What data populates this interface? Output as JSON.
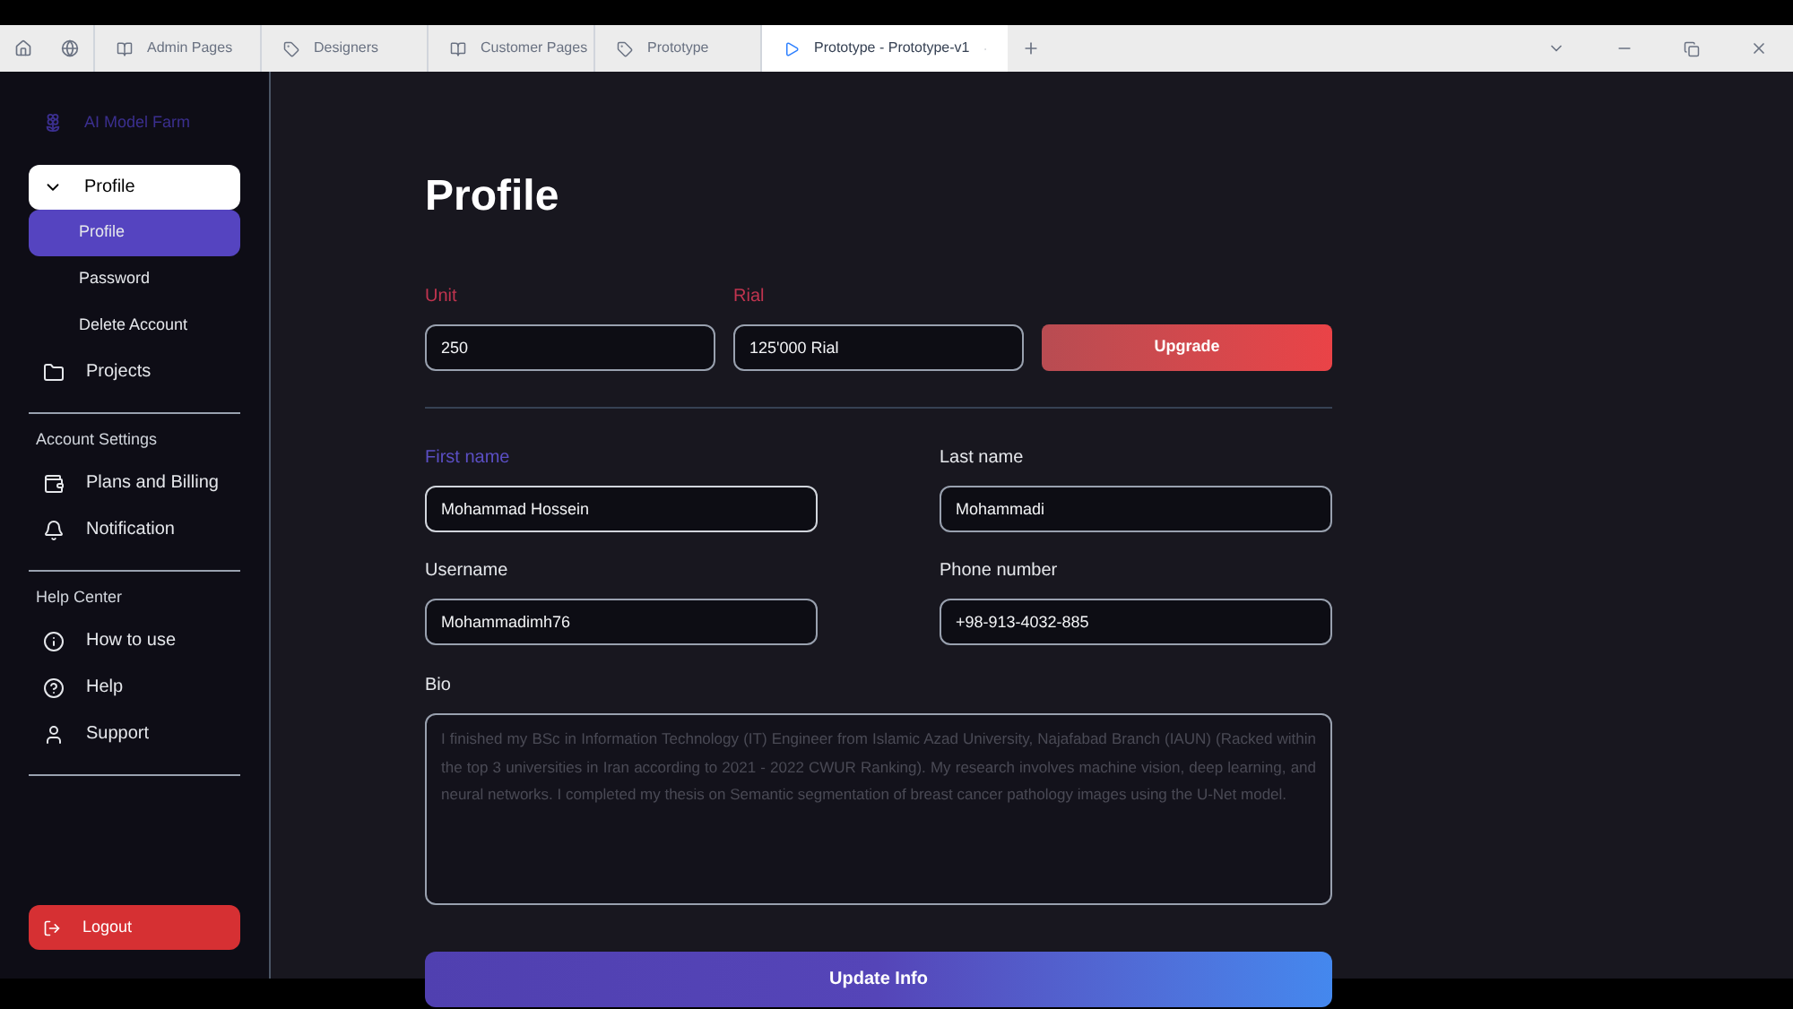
{
  "browser": {
    "tabs": [
      {
        "label": "Admin Pages",
        "selected": false
      },
      {
        "label": "Designers",
        "selected": false
      },
      {
        "label": "Customer Pages",
        "selected": false
      },
      {
        "label": "Prototype",
        "selected": false
      },
      {
        "label": "Prototype - Prototype-v1",
        "selected": true
      }
    ]
  },
  "sidebar": {
    "brand": "AI Model Farm",
    "group": {
      "label": "Profile",
      "expanded": true,
      "children": [
        {
          "label": "Profile",
          "selected": true
        },
        {
          "label": "Password",
          "selected": false
        },
        {
          "label": "Delete Account",
          "selected": false
        }
      ]
    },
    "items": [
      {
        "label": "Projects"
      }
    ],
    "sections": [
      {
        "title": "Account Settings",
        "items": [
          {
            "label": "Plans and Billing"
          },
          {
            "label": "Notification"
          }
        ]
      },
      {
        "title": "Help Center",
        "items": [
          {
            "label": "How to use"
          },
          {
            "label": "Help"
          },
          {
            "label": "Support"
          }
        ]
      }
    ],
    "logout": "Logout"
  },
  "page": {
    "title": "Profile",
    "plan": [
      {
        "label": "Unit",
        "value": "250"
      },
      {
        "label": "Rial",
        "value": "125'000 Rial"
      }
    ],
    "upgrade": "Upgrade",
    "fields": [
      {
        "label": "First name",
        "value": "Mohammad Hossein",
        "focused": true
      },
      {
        "label": "Last name",
        "value": "Mohammadi",
        "focused": false
      },
      {
        "label": "Username",
        "value": "Mohammadimh76",
        "focused": false
      },
      {
        "label": "Phone number",
        "value": "+98-913-4032-885",
        "focused": false
      }
    ],
    "bio": {
      "label": "Bio",
      "placeholder": "I finished my BSc in Information Technology (IT) Engineer from Islamic Azad University, Najafabad Branch (IAUN) (Racked within the top 3 universities in Iran according to 2021 - 2022 CWUR Ranking). My research involves machine vision, deep learning, and neural networks. I completed my thesis on Semantic segmentation of breast cancer pathology images using the U-Net model."
    },
    "submit": "Update Info"
  }
}
